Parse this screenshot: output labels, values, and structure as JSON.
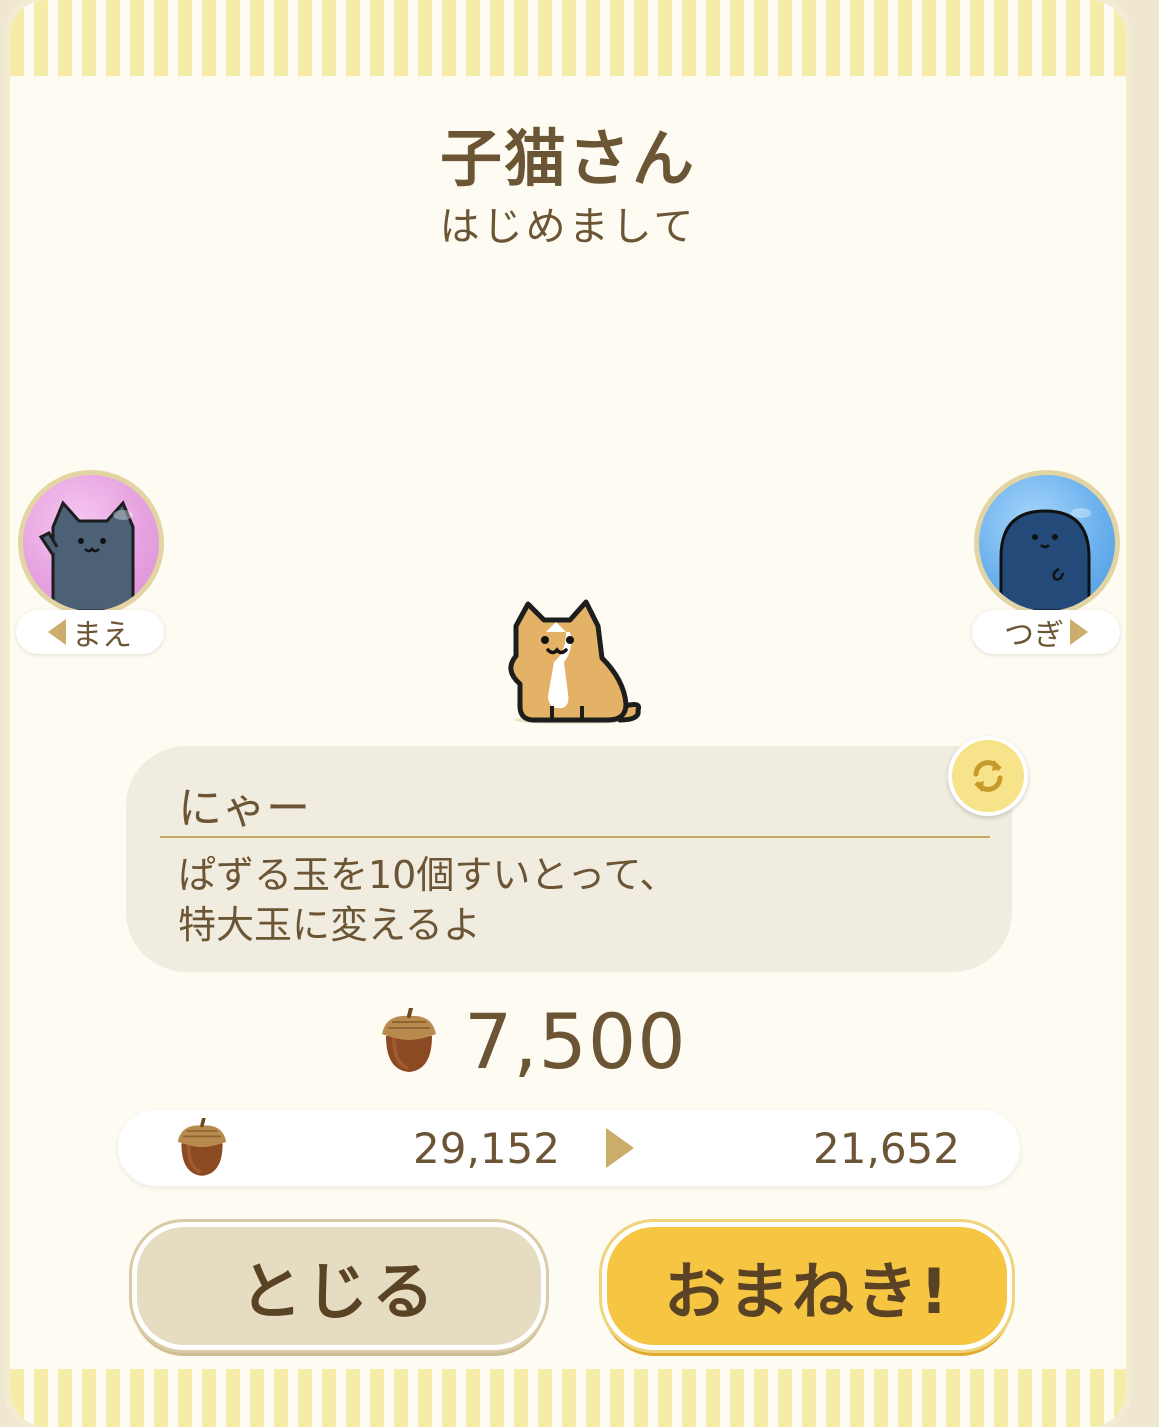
{
  "title": "子猫さん",
  "subtitle": "はじめまして",
  "nav": {
    "prev_label": "まえ",
    "next_label": "つぎ"
  },
  "speech": {
    "name": "にゃー",
    "desc_line1": "ぱずる玉を10個すいとって、",
    "desc_line2": "特大玉に変えるよ"
  },
  "cost": {
    "value": "7,500",
    "icon": "acorn-icon"
  },
  "balance": {
    "before": "29,152",
    "after": "21,652"
  },
  "buttons": {
    "close_label": "とじる",
    "invite_label": "おまねき!"
  },
  "colors": {
    "text": "#6b5535",
    "stripe": "#f5eda7",
    "prev_bg": "#e6a2e0",
    "next_bg": "#6cb1ee",
    "invite_button": "#f6c542",
    "close_button": "#e6dcc2"
  }
}
